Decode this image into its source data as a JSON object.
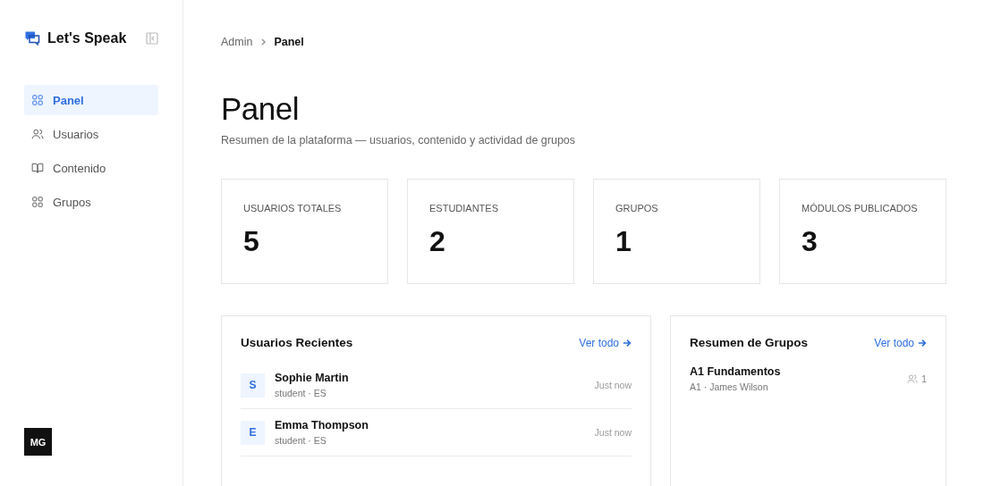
{
  "sidebar": {
    "brand": "Let's Speak",
    "items": [
      {
        "label": "Panel",
        "selected": true
      },
      {
        "label": "Usuarios",
        "selected": false
      },
      {
        "label": "Contenido",
        "selected": false
      },
      {
        "label": "Grupos",
        "selected": false
      }
    ],
    "user_initials": "MG"
  },
  "breadcrumb": [
    "Admin",
    "Panel"
  ],
  "title": "Panel",
  "subtitle": "Resumen de la plataforma — usuarios, contenido y actividad de grupos",
  "stats": [
    {
      "label": "USUARIOS TOTALES",
      "value": "5"
    },
    {
      "label": "ESTUDIANTES",
      "value": "2"
    },
    {
      "label": "GRUPOS",
      "value": "1"
    },
    {
      "label": "MÓDULOS PUBLICADOS",
      "value": "3"
    }
  ],
  "recent_users": {
    "title": "Usuarios Recientes",
    "link": "Ver todo",
    "rows": [
      {
        "initial": "S",
        "name": "Sophie Martin",
        "meta": "student · ES",
        "time": "Just now"
      },
      {
        "initial": "E",
        "name": "Emma Thompson",
        "meta": "student · ES",
        "time": "Just now"
      }
    ]
  },
  "groups": {
    "title": "Resumen de Grupos",
    "link": "Ver todo",
    "rows": [
      {
        "name": "A1 Fundamentos",
        "meta": "A1 · James Wilson",
        "count": "1"
      }
    ]
  }
}
